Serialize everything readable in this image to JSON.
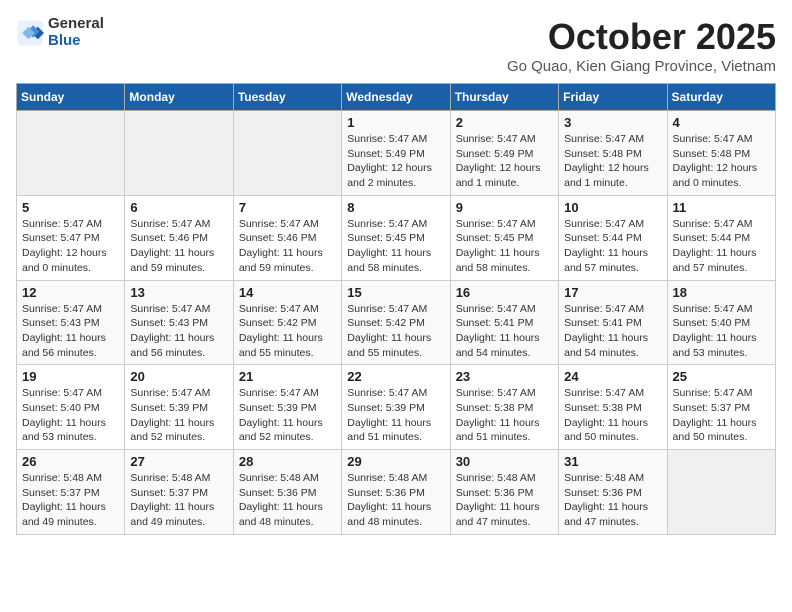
{
  "header": {
    "logo_general": "General",
    "logo_blue": "Blue",
    "month_title": "October 2025",
    "subtitle": "Go Quao, Kien Giang Province, Vietnam"
  },
  "days_of_week": [
    "Sunday",
    "Monday",
    "Tuesday",
    "Wednesday",
    "Thursday",
    "Friday",
    "Saturday"
  ],
  "weeks": [
    [
      {
        "day": "",
        "info": ""
      },
      {
        "day": "",
        "info": ""
      },
      {
        "day": "",
        "info": ""
      },
      {
        "day": "1",
        "info": "Sunrise: 5:47 AM\nSunset: 5:49 PM\nDaylight: 12 hours\nand 2 minutes."
      },
      {
        "day": "2",
        "info": "Sunrise: 5:47 AM\nSunset: 5:49 PM\nDaylight: 12 hours\nand 1 minute."
      },
      {
        "day": "3",
        "info": "Sunrise: 5:47 AM\nSunset: 5:48 PM\nDaylight: 12 hours\nand 1 minute."
      },
      {
        "day": "4",
        "info": "Sunrise: 5:47 AM\nSunset: 5:48 PM\nDaylight: 12 hours\nand 0 minutes."
      }
    ],
    [
      {
        "day": "5",
        "info": "Sunrise: 5:47 AM\nSunset: 5:47 PM\nDaylight: 12 hours\nand 0 minutes."
      },
      {
        "day": "6",
        "info": "Sunrise: 5:47 AM\nSunset: 5:46 PM\nDaylight: 11 hours\nand 59 minutes."
      },
      {
        "day": "7",
        "info": "Sunrise: 5:47 AM\nSunset: 5:46 PM\nDaylight: 11 hours\nand 59 minutes."
      },
      {
        "day": "8",
        "info": "Sunrise: 5:47 AM\nSunset: 5:45 PM\nDaylight: 11 hours\nand 58 minutes."
      },
      {
        "day": "9",
        "info": "Sunrise: 5:47 AM\nSunset: 5:45 PM\nDaylight: 11 hours\nand 58 minutes."
      },
      {
        "day": "10",
        "info": "Sunrise: 5:47 AM\nSunset: 5:44 PM\nDaylight: 11 hours\nand 57 minutes."
      },
      {
        "day": "11",
        "info": "Sunrise: 5:47 AM\nSunset: 5:44 PM\nDaylight: 11 hours\nand 57 minutes."
      }
    ],
    [
      {
        "day": "12",
        "info": "Sunrise: 5:47 AM\nSunset: 5:43 PM\nDaylight: 11 hours\nand 56 minutes."
      },
      {
        "day": "13",
        "info": "Sunrise: 5:47 AM\nSunset: 5:43 PM\nDaylight: 11 hours\nand 56 minutes."
      },
      {
        "day": "14",
        "info": "Sunrise: 5:47 AM\nSunset: 5:42 PM\nDaylight: 11 hours\nand 55 minutes."
      },
      {
        "day": "15",
        "info": "Sunrise: 5:47 AM\nSunset: 5:42 PM\nDaylight: 11 hours\nand 55 minutes."
      },
      {
        "day": "16",
        "info": "Sunrise: 5:47 AM\nSunset: 5:41 PM\nDaylight: 11 hours\nand 54 minutes."
      },
      {
        "day": "17",
        "info": "Sunrise: 5:47 AM\nSunset: 5:41 PM\nDaylight: 11 hours\nand 54 minutes."
      },
      {
        "day": "18",
        "info": "Sunrise: 5:47 AM\nSunset: 5:40 PM\nDaylight: 11 hours\nand 53 minutes."
      }
    ],
    [
      {
        "day": "19",
        "info": "Sunrise: 5:47 AM\nSunset: 5:40 PM\nDaylight: 11 hours\nand 53 minutes."
      },
      {
        "day": "20",
        "info": "Sunrise: 5:47 AM\nSunset: 5:39 PM\nDaylight: 11 hours\nand 52 minutes."
      },
      {
        "day": "21",
        "info": "Sunrise: 5:47 AM\nSunset: 5:39 PM\nDaylight: 11 hours\nand 52 minutes."
      },
      {
        "day": "22",
        "info": "Sunrise: 5:47 AM\nSunset: 5:39 PM\nDaylight: 11 hours\nand 51 minutes."
      },
      {
        "day": "23",
        "info": "Sunrise: 5:47 AM\nSunset: 5:38 PM\nDaylight: 11 hours\nand 51 minutes."
      },
      {
        "day": "24",
        "info": "Sunrise: 5:47 AM\nSunset: 5:38 PM\nDaylight: 11 hours\nand 50 minutes."
      },
      {
        "day": "25",
        "info": "Sunrise: 5:47 AM\nSunset: 5:37 PM\nDaylight: 11 hours\nand 50 minutes."
      }
    ],
    [
      {
        "day": "26",
        "info": "Sunrise: 5:48 AM\nSunset: 5:37 PM\nDaylight: 11 hours\nand 49 minutes."
      },
      {
        "day": "27",
        "info": "Sunrise: 5:48 AM\nSunset: 5:37 PM\nDaylight: 11 hours\nand 49 minutes."
      },
      {
        "day": "28",
        "info": "Sunrise: 5:48 AM\nSunset: 5:36 PM\nDaylight: 11 hours\nand 48 minutes."
      },
      {
        "day": "29",
        "info": "Sunrise: 5:48 AM\nSunset: 5:36 PM\nDaylight: 11 hours\nand 48 minutes."
      },
      {
        "day": "30",
        "info": "Sunrise: 5:48 AM\nSunset: 5:36 PM\nDaylight: 11 hours\nand 47 minutes."
      },
      {
        "day": "31",
        "info": "Sunrise: 5:48 AM\nSunset: 5:36 PM\nDaylight: 11 hours\nand 47 minutes."
      },
      {
        "day": "",
        "info": ""
      }
    ]
  ]
}
